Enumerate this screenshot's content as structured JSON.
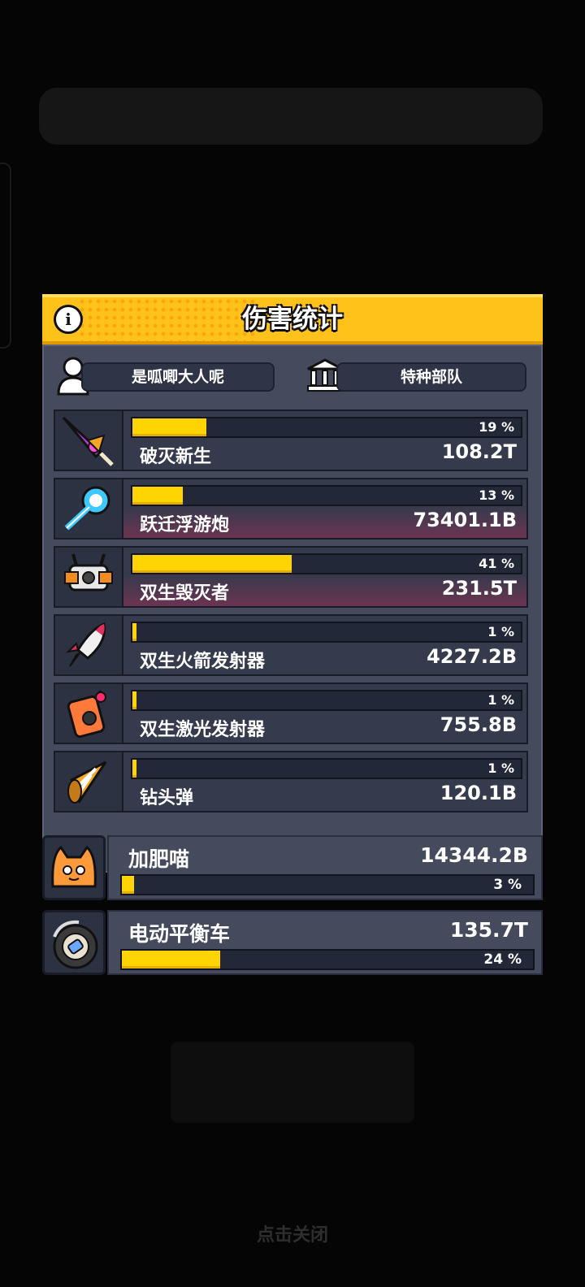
{
  "dialog": {
    "title": "伤害统计",
    "player_name": "是呱唧大人呢",
    "guild_name": "特种部队"
  },
  "weapons": [
    {
      "icon": "purple-sword-icon",
      "name": "破灭新生",
      "value": "108.2T",
      "percent_label": "19 %",
      "percent": 19,
      "highlight": false
    },
    {
      "icon": "blue-warp-cannon-icon",
      "name": "跃迁浮游炮",
      "value": "73401.1B",
      "percent_label": "13 %",
      "percent": 13,
      "highlight": true
    },
    {
      "icon": "twin-destroyer-drone-icon",
      "name": "双生毁灭者",
      "value": "231.5T",
      "percent_label": "41 %",
      "percent": 41,
      "highlight": true
    },
    {
      "icon": "rocket-icon",
      "name": "双生火箭发射器",
      "value": "4227.2B",
      "percent_label": "1 %",
      "percent": 1,
      "highlight": false
    },
    {
      "icon": "laser-emitter-icon",
      "name": "双生激光发射器",
      "value": "755.8B",
      "percent_label": "1 %",
      "percent": 1,
      "highlight": false
    },
    {
      "icon": "drill-shell-icon",
      "name": "钻头弹",
      "value": "120.1B",
      "percent_label": "1 %",
      "percent": 1,
      "highlight": false
    }
  ],
  "pets": [
    {
      "icon": "orange-cat-icon",
      "name": "加肥喵",
      "value": "14344.2B",
      "percent_label": "3 %",
      "percent": 3
    },
    {
      "icon": "balance-wheel-icon",
      "name": "电动平衡车",
      "value": "135.7T",
      "percent_label": "24 %",
      "percent": 24
    }
  ],
  "close_hint": "点击关闭",
  "colors": {
    "title_bar": "#ffc21a",
    "panel": "#454a5d",
    "bar_fill": "#ffd400",
    "highlight": "#6b3452"
  }
}
